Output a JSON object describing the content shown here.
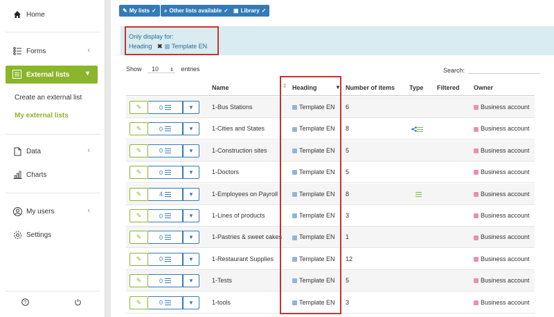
{
  "sidebar": {
    "home": "Home",
    "forms": "Forms",
    "external_lists": "External lists",
    "create_list": "Create an external list",
    "my_lists": "My external lists",
    "data": "Data",
    "charts": "Charts",
    "my_users": "My users",
    "settings": "Settings"
  },
  "toolbar": {
    "my_lists": "My lists",
    "other_lists": "Other lists available",
    "library": "Library"
  },
  "filter": {
    "label": "Only display for:",
    "field": "Heading",
    "value": "Template EN"
  },
  "table_controls": {
    "show": "Show",
    "entries_value": "10",
    "entries": "entries",
    "search": "Search:"
  },
  "columns": {
    "name": "Name",
    "heading": "Heading",
    "items": "Number of items",
    "type": "Type",
    "filtered": "Filtered",
    "owner": "Owner"
  },
  "rows": [
    {
      "count": "0",
      "name": "1-Bus Stations",
      "heading": "Template EN",
      "items": "6",
      "type": "",
      "owner": "Business account"
    },
    {
      "count": "0",
      "name": "1-Cities and States",
      "heading": "Template EN",
      "items": "8",
      "type": "share-list",
      "owner": "Business account"
    },
    {
      "count": "0",
      "name": "1-Construction sites",
      "heading": "Template EN",
      "items": "5",
      "type": "",
      "owner": "Business account"
    },
    {
      "count": "0",
      "name": "1-Doctors",
      "heading": "Template EN",
      "items": "5",
      "type": "",
      "owner": "Business account"
    },
    {
      "count": "4",
      "name": "1-Employees on Payroll",
      "heading": "Template EN",
      "items": "8",
      "type": "list",
      "owner": "Business account"
    },
    {
      "count": "0",
      "name": "1-Lines of products",
      "heading": "Template EN",
      "items": "3",
      "type": "",
      "owner": "Business account"
    },
    {
      "count": "0",
      "name": "1-Pastries & sweet cakes",
      "heading": "Template EN",
      "items": "1",
      "type": "",
      "owner": "Business account"
    },
    {
      "count": "0",
      "name": "1-Restaurant Supplies",
      "heading": "Template EN",
      "items": "12",
      "type": "",
      "owner": "Business account"
    },
    {
      "count": "0",
      "name": "1-Tests",
      "heading": "Template EN",
      "items": "5",
      "type": "",
      "owner": "Business account"
    },
    {
      "count": "0",
      "name": "1-tools",
      "heading": "Template EN",
      "items": "3",
      "type": "",
      "owner": "Business account"
    }
  ],
  "colors": {
    "accent_green": "#8bb52a",
    "primary_blue": "#337ab7",
    "highlight_red": "#c9302c",
    "heading_square": "#8fb6d8",
    "owner_square": "#ea8fb4"
  }
}
